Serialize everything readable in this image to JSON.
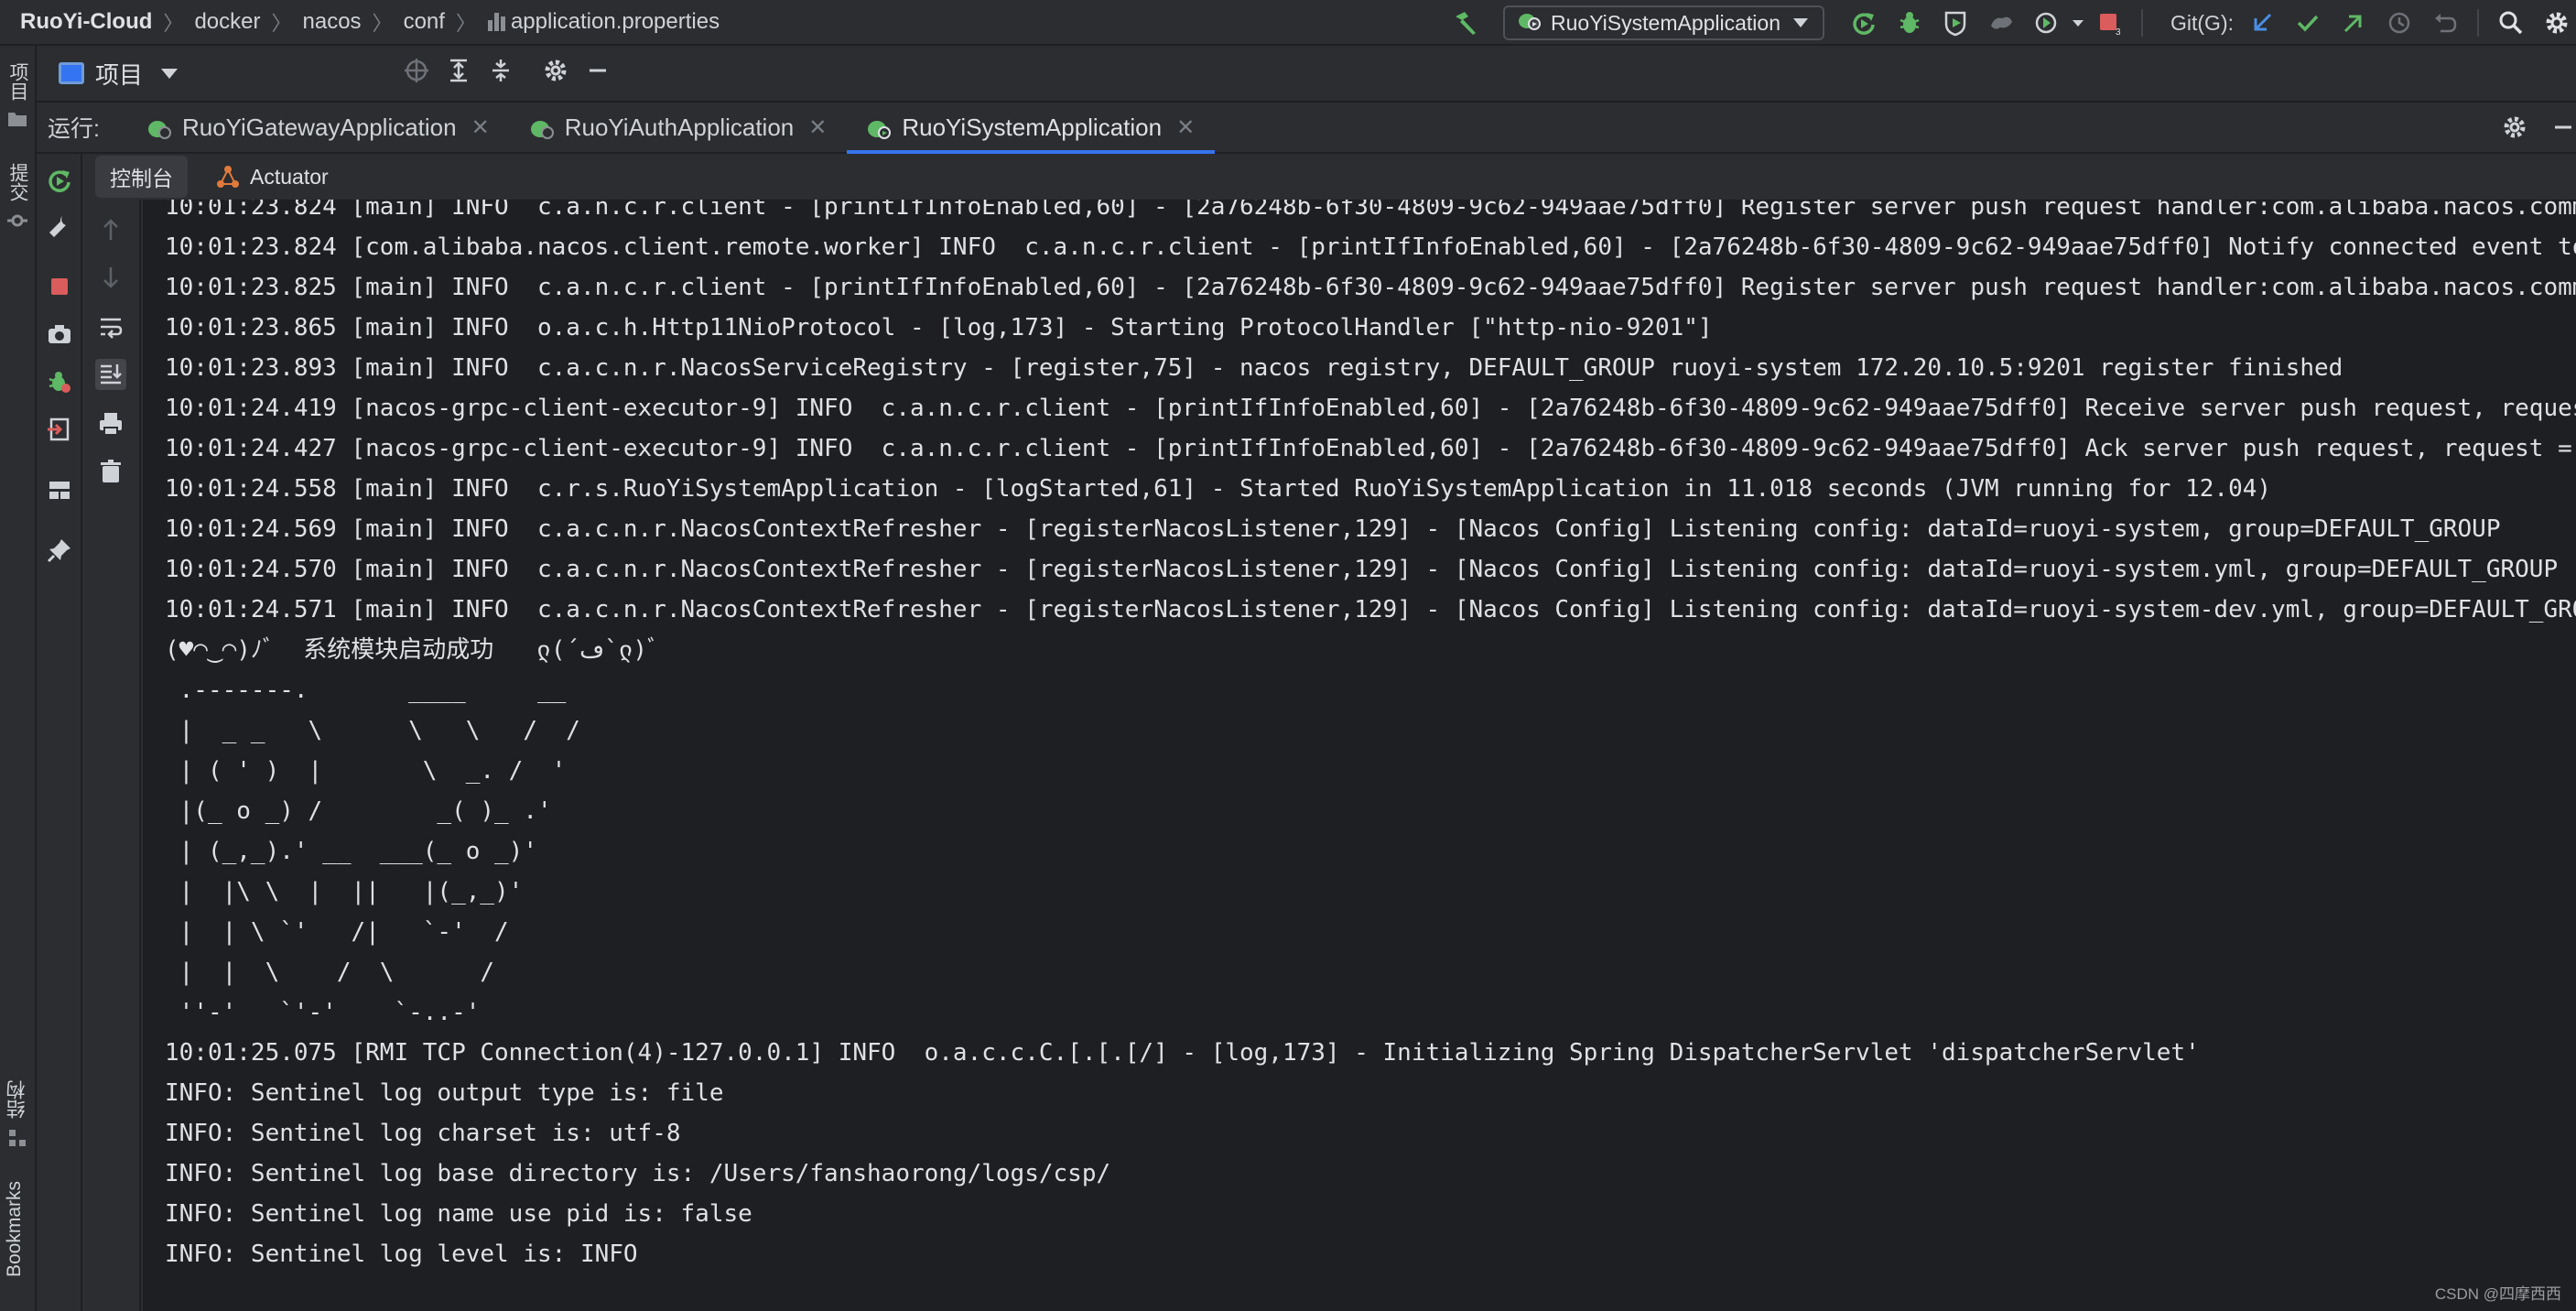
{
  "breadcrumbs": [
    "RuoYi-Cloud",
    "docker",
    "nacos",
    "conf",
    "application.properties"
  ],
  "toolbar": {
    "run_config": "RuoYiSystemApplication",
    "git_label": "Git(G):",
    "icons": [
      "build-icon",
      "run-config-icon",
      "rerun-icon",
      "debug-icon",
      "coverage-icon",
      "profiler-icon",
      "run-more-icon",
      "stop-icon",
      "git-update-icon",
      "git-commit-icon",
      "git-push-icon",
      "history-icon",
      "rollback-icon",
      "search-icon",
      "settings-icon"
    ]
  },
  "side_strip": {
    "top_label": "项目",
    "commit_label": "提交",
    "structure_label": "结构",
    "bookmarks_label": "Bookmarks"
  },
  "project_row": {
    "title": "项目"
  },
  "run_row": {
    "label": "运行:",
    "tabs": [
      {
        "label": "RuoYiGatewayApplication",
        "active": false
      },
      {
        "label": "RuoYiAuthApplication",
        "active": false
      },
      {
        "label": "RuoYiSystemApplication",
        "active": true
      }
    ]
  },
  "sub_tabs": [
    {
      "label": "控制台",
      "active": true
    },
    {
      "label": "Actuator",
      "active": false
    }
  ],
  "console": {
    "lines": [
      "10:01:23.824 [main] INFO  c.a.n.c.r.client - [printIfInfoEnabled,60] - [2a76248b-6f30-4809-9c62-949aae75dff0] Register server push request handler:com.alibaba.nacos.comm",
      "10:01:23.824 [com.alibaba.nacos.client.remote.worker] INFO  c.a.n.c.r.client - [printIfInfoEnabled,60] - [2a76248b-6f30-4809-9c62-949aae75dff0] Notify connected event to",
      "10:01:23.825 [main] INFO  c.a.n.c.r.client - [printIfInfoEnabled,60] - [2a76248b-6f30-4809-9c62-949aae75dff0] Register server push request handler:com.alibaba.nacos.comm",
      "10:01:23.865 [main] INFO  o.a.c.h.Http11NioProtocol - [log,173] - Starting ProtocolHandler [\"http-nio-9201\"]",
      "10:01:23.893 [main] INFO  c.a.c.n.r.NacosServiceRegistry - [register,75] - nacos registry, DEFAULT_GROUP ruoyi-system 172.20.10.5:9201 register finished",
      "10:01:24.419 [nacos-grpc-client-executor-9] INFO  c.a.n.c.r.client - [printIfInfoEnabled,60] - [2a76248b-6f30-4809-9c62-949aae75dff0] Receive server push request, reques",
      "10:01:24.427 [nacos-grpc-client-executor-9] INFO  c.a.n.c.r.client - [printIfInfoEnabled,60] - [2a76248b-6f30-4809-9c62-949aae75dff0] Ack server push request, request =",
      "10:01:24.558 [main] INFO  c.r.s.RuoYiSystemApplication - [logStarted,61] - Started RuoYiSystemApplication in 11.018 seconds (JVM running for 12.04)",
      "10:01:24.569 [main] INFO  c.a.c.n.r.NacosContextRefresher - [registerNacosListener,129] - [Nacos Config] Listening config: dataId=ruoyi-system, group=DEFAULT_GROUP",
      "10:01:24.570 [main] INFO  c.a.c.n.r.NacosContextRefresher - [registerNacosListener,129] - [Nacos Config] Listening config: dataId=ruoyi-system.yml, group=DEFAULT_GROUP",
      "10:01:24.571 [main] INFO  c.a.c.n.r.NacosContextRefresher - [registerNacosListener,129] - [Nacos Config] Listening config: dataId=ruoyi-system-dev.yml, group=DEFAULT_GRO",
      "(♥◠‿◠)ﾉﾞ  系统模块启动成功   ლ(´ڡ`ლ)ﾞ",
      " .-------.       ____     __",
      " |  _ _   \\      \\   \\   /  /",
      " | ( ' )  |       \\  _. /  '",
      " |(_ o _) /        _( )_ .'",
      " | (_,_).' __  ___(_ o _)'",
      " |  |\\ \\  |  ||   |(_,_)'",
      " |  | \\ `'   /|   `-'  /",
      " |  |  \\    /  \\      /",
      " ''-'   `'-'    `-..-'",
      "10:01:25.075 [RMI TCP Connection(4)-127.0.0.1] INFO  o.a.c.c.C.[.[.[/] - [log,173] - Initializing Spring DispatcherServlet 'dispatcherServlet'",
      "INFO: Sentinel log output type is: file",
      "INFO: Sentinel log charset is: utf-8",
      "INFO: Sentinel log base directory is: /Users/fanshaorong/logs/csp/",
      "INFO: Sentinel log name use pid is: false",
      "INFO: Sentinel log level is: INFO"
    ]
  },
  "watermark": "CSDN @四摩西西",
  "colors": {
    "accent": "#3574f0",
    "run_green": "#5fb865",
    "stop_red": "#db5c5c",
    "console_bg": "#1e1f22",
    "panel_bg": "#2b2d30"
  }
}
